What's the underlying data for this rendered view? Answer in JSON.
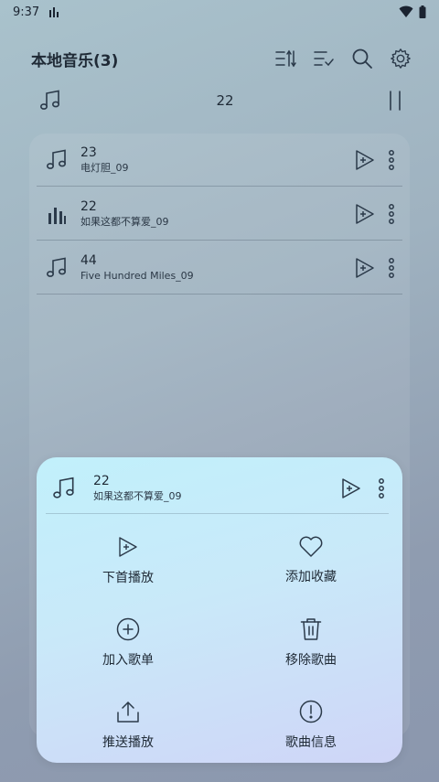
{
  "status": {
    "time": "9:37"
  },
  "header": {
    "title": "本地音乐(3)",
    "icons": [
      "sort-icon",
      "select-list-icon",
      "search-icon",
      "gear-icon"
    ]
  },
  "now_playing": {
    "title": "22"
  },
  "songs": [
    {
      "title": "23",
      "subtitle": "电灯胆_09",
      "playing": false
    },
    {
      "title": "22",
      "subtitle": "如果这都不算爱_09",
      "playing": true
    },
    {
      "title": "44",
      "subtitle": "Five Hundred Miles_09",
      "playing": false
    }
  ],
  "sheet": {
    "song_title": "22",
    "song_subtitle": "如果这都不算爱_09",
    "actions": [
      {
        "label": "下首播放",
        "icon": "play-next-icon"
      },
      {
        "label": "添加收藏",
        "icon": "heart-icon"
      },
      {
        "label": "加入歌单",
        "icon": "add-circle-icon"
      },
      {
        "label": "移除歌曲",
        "icon": "trash-icon"
      },
      {
        "label": "推送播放",
        "icon": "share-icon"
      },
      {
        "label": "歌曲信息",
        "icon": "info-icon"
      }
    ]
  },
  "colors": {
    "icon": "#2b3a4a",
    "text": "#1f2a36"
  }
}
